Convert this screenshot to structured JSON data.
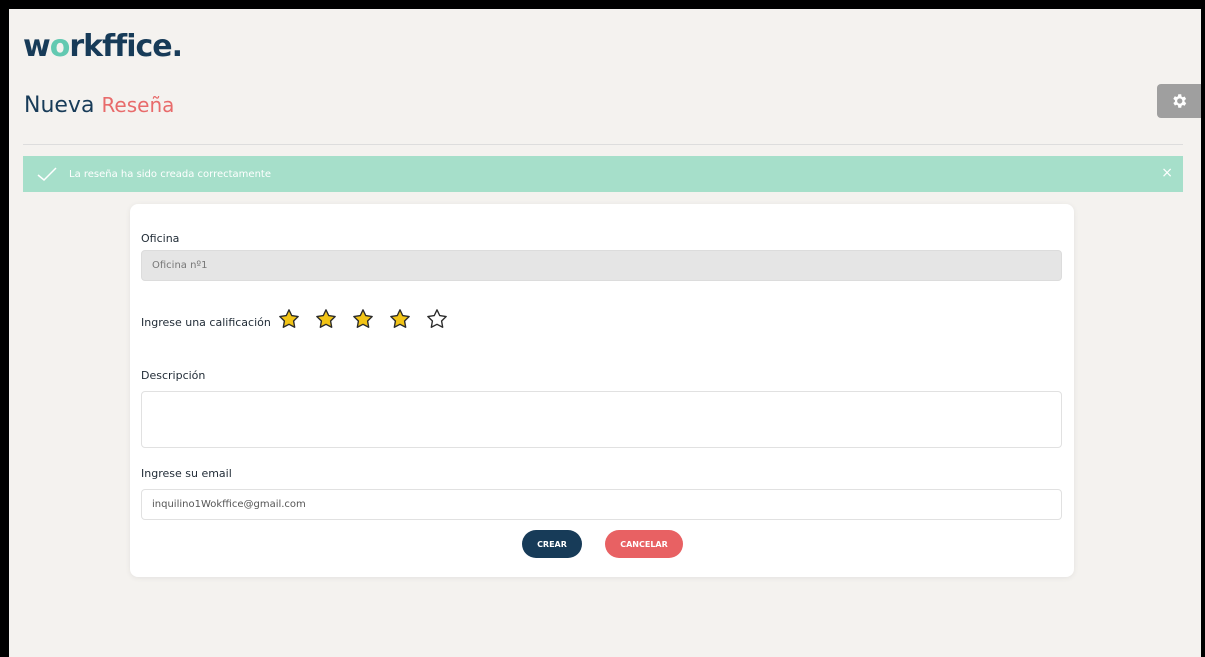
{
  "header": {
    "logo_text_prefix": "w",
    "logo_text_o": "o",
    "logo_text_suffix": "rkffice.",
    "title_main": "Nueva",
    "title_accent": "Reseña"
  },
  "alert": {
    "message": "La reseña ha sido creada correctamente",
    "close_icon": "×"
  },
  "form": {
    "office_label": "Oficina",
    "office_value": "Oficina nº1",
    "rating_label": "Ingrese una calificación",
    "rating": 4,
    "rating_max": 5,
    "description_label": "Descripción",
    "description_value": "",
    "email_label": "Ingrese su email",
    "email_value": "inquilino1Wokffice@gmail.com"
  },
  "buttons": {
    "create": "CREAR",
    "cancel": "CANCELAR"
  },
  "colors": {
    "brand_dark": "#173b58",
    "brand_accent": "#e86b6b",
    "alert_bg": "#a6dfca",
    "star_fill": "#f2c416"
  }
}
